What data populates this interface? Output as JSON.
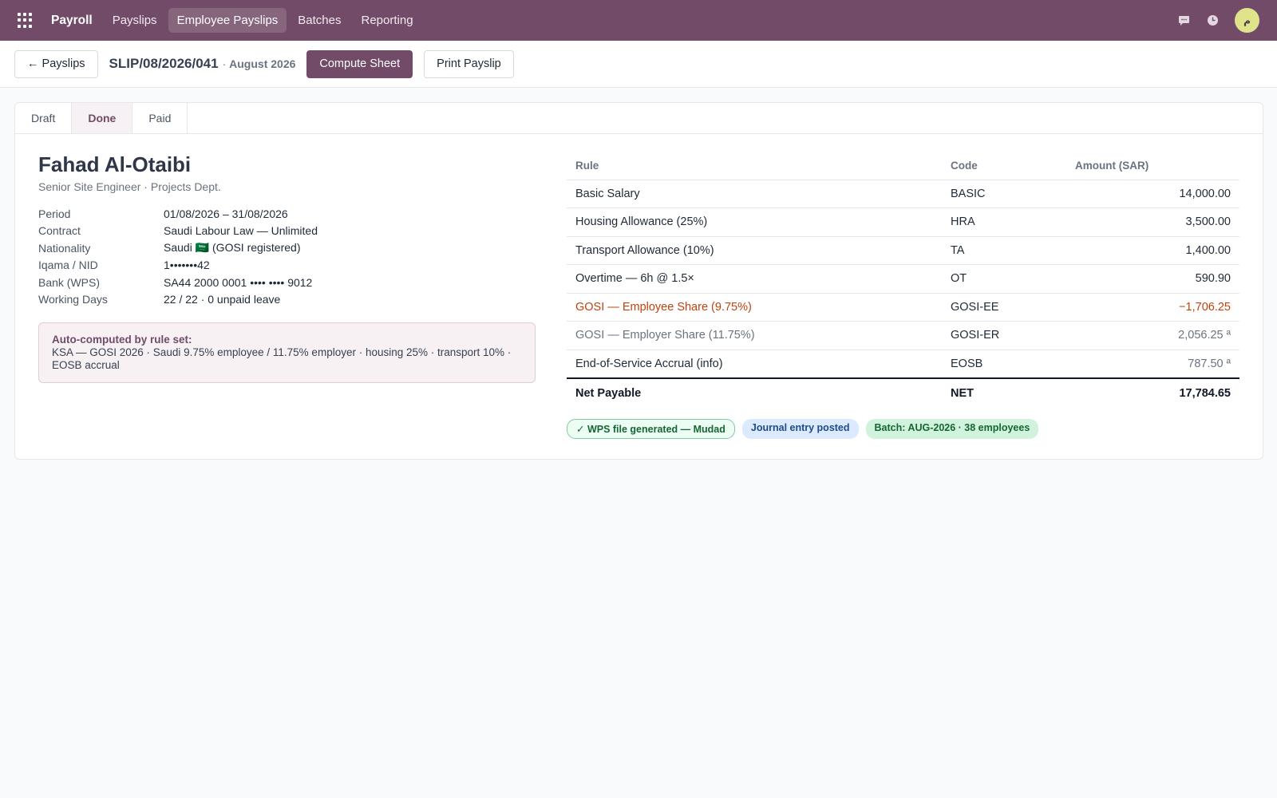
{
  "nav": {
    "brand": "Payroll",
    "items": [
      {
        "label": "Payslips"
      },
      {
        "label": "Employee Payslips"
      },
      {
        "label": "Batches"
      },
      {
        "label": "Reporting"
      }
    ],
    "avatar_initial": "م"
  },
  "controls": {
    "back_label": "← Payslips",
    "slip_ref": "SLIP/08/2026/041",
    "slip_sep": "·",
    "slip_month": "August 2026",
    "compute_label": "Compute Sheet",
    "print_label": "Print Payslip"
  },
  "status": {
    "stages": [
      "Draft",
      "Done",
      "Paid"
    ],
    "current": "Done"
  },
  "employee": {
    "name": "Fahad Al-Otaibi",
    "role": "Senior Site Engineer · Projects Dept.",
    "fields": [
      {
        "label": "Period",
        "value": "01/08/2026 – 31/08/2026"
      },
      {
        "label": "Contract",
        "value": "Saudi Labour Law — Unlimited"
      },
      {
        "label": "Nationality",
        "value": "Saudi 🇸🇦 (GOSI registered)"
      },
      {
        "label": "Iqama / NID",
        "value": "1•••••••42"
      },
      {
        "label": "Bank (WPS)",
        "value": "SA44 2000 0001 •••• •••• 9012"
      },
      {
        "label": "Working Days",
        "value": "22 / 22 · 0 unpaid leave"
      }
    ],
    "notice_title": "Auto-computed by rule set:",
    "notice_body": "KSA — GOSI 2026 · Saudi 9.75% employee / 11.75% employer · housing 25% · transport 10% · EOSB accrual"
  },
  "lines": {
    "headers": {
      "rule": "Rule",
      "code": "Code",
      "amount": "Amount (SAR)"
    },
    "rows": [
      {
        "rule": "Basic Salary",
        "code": "BASIC",
        "amount": "14,000.00",
        "kind": "normal"
      },
      {
        "rule": "Housing Allowance (25%)",
        "code": "HRA",
        "amount": "3,500.00",
        "kind": "normal"
      },
      {
        "rule": "Transport Allowance (10%)",
        "code": "TA",
        "amount": "1,400.00",
        "kind": "normal"
      },
      {
        "rule": "Overtime — 6h @ 1.5×",
        "code": "OT",
        "amount": "590.90",
        "kind": "normal"
      },
      {
        "rule": "GOSI — Employee Share (9.75%)",
        "code": "GOSI-EE",
        "amount": "−1,706.25",
        "kind": "deduction"
      },
      {
        "rule": "GOSI — Employer Share (11.75%)",
        "code": "GOSI-ER",
        "amount": "2,056.25 ª",
        "kind": "info"
      },
      {
        "rule": "End-of-Service Accrual (info)",
        "code": "EOSB",
        "amount": "787.50 ª",
        "kind": "info-dark"
      }
    ],
    "total": {
      "rule": "Net Payable",
      "code": "NET",
      "amount": "17,784.65"
    }
  },
  "badges": {
    "wps": "✓ WPS file generated — Mudad",
    "journal": "Journal entry posted",
    "batch": "Batch: AUG-2026 · 38 employees"
  },
  "colors": {
    "brand": "#714b67",
    "deduction": "#c2410c"
  }
}
